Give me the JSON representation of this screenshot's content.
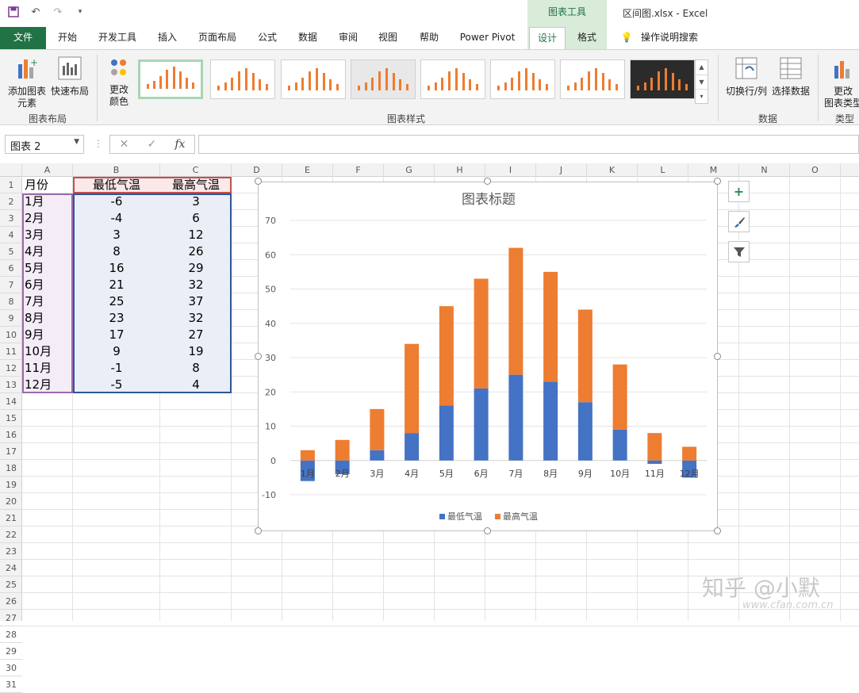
{
  "titlebar": {
    "context_tab": "图表工具",
    "doc_title": "区间图.xlsx  -  Excel"
  },
  "tabs": [
    "文件",
    "开始",
    "开发工具",
    "插入",
    "页面布局",
    "公式",
    "数据",
    "审阅",
    "视图",
    "帮助",
    "Power Pivot",
    "设计",
    "格式",
    "操作说明搜索"
  ],
  "ribbon": {
    "add_element": "添加图表\n元素",
    "quick_layout": "快速布局",
    "change_color": "更改\n颜色",
    "group_layout": "图表布局",
    "group_styles": "图表样式",
    "switch_rowcol": "切换行/列",
    "select_data": "选择数据",
    "group_data": "数据",
    "change_type": "更改\n图表类型",
    "group_type": "类型"
  },
  "formulabar": {
    "namebox": "图表 2",
    "fx": "fx"
  },
  "columns": [
    "A",
    "B",
    "C",
    "D",
    "E",
    "F",
    "G",
    "H",
    "I",
    "J",
    "K",
    "L",
    "M",
    "N",
    "O"
  ],
  "rows": [
    "1",
    "2",
    "3",
    "4",
    "5",
    "6",
    "7",
    "8",
    "9",
    "10",
    "11",
    "12",
    "13",
    "14",
    "15",
    "16",
    "17",
    "18",
    "19",
    "20",
    "21",
    "22",
    "23",
    "24",
    "25",
    "26",
    "27",
    "28",
    "29",
    "30",
    "31"
  ],
  "table": {
    "headers": [
      "月份",
      "最低气温",
      "最高气温"
    ],
    "rows": [
      [
        "1月",
        "-6",
        "3"
      ],
      [
        "2月",
        "-4",
        "6"
      ],
      [
        "3月",
        "3",
        "12"
      ],
      [
        "4月",
        "8",
        "26"
      ],
      [
        "5月",
        "16",
        "29"
      ],
      [
        "6月",
        "21",
        "32"
      ],
      [
        "7月",
        "25",
        "37"
      ],
      [
        "8月",
        "23",
        "32"
      ],
      [
        "9月",
        "17",
        "27"
      ],
      [
        "10月",
        "9",
        "19"
      ],
      [
        "11月",
        "-1",
        "8"
      ],
      [
        "12月",
        "-5",
        "4"
      ]
    ]
  },
  "chart_data": {
    "type": "bar",
    "stacked": true,
    "title": "图表标题",
    "categories": [
      "1月",
      "2月",
      "3月",
      "4月",
      "5月",
      "6月",
      "7月",
      "8月",
      "9月",
      "10月",
      "11月",
      "12月"
    ],
    "series": [
      {
        "name": "最低气温",
        "values": [
          -6,
          -4,
          3,
          8,
          16,
          21,
          25,
          23,
          17,
          9,
          -1,
          -5
        ],
        "color": "#4472c4"
      },
      {
        "name": "最高气温",
        "values": [
          3,
          6,
          12,
          26,
          29,
          32,
          37,
          32,
          27,
          19,
          8,
          4
        ],
        "color": "#ed7d31"
      }
    ],
    "ylim": [
      -10,
      70
    ],
    "yticks": [
      -10,
      0,
      10,
      20,
      30,
      40,
      50,
      60,
      70
    ],
    "grid": true,
    "legend": "bottom"
  },
  "watermark": "知乎 @小默",
  "watermark_site": "www.cfan.com.cn"
}
